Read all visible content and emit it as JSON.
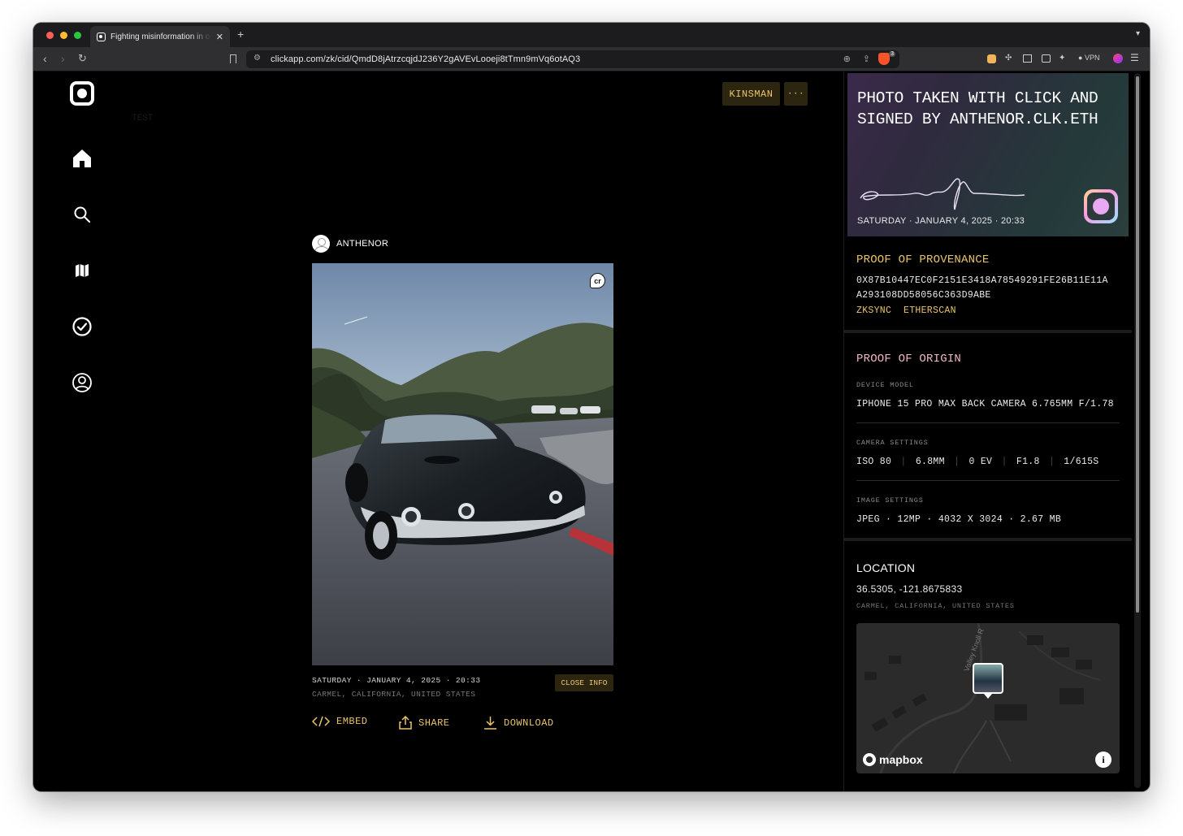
{
  "browser": {
    "tab_title": "Fighting misinformation in onchain photography",
    "url": "clickapp.com/zk/cid/QmdD8jAtrzcqjdJ236Y2gAVEvLooeji8tTmn9mVq6otAQ3",
    "vpn_label": "VPN",
    "brave_badge": "3"
  },
  "sidebar": {
    "ghost_text": "TEST",
    "items": [
      {
        "name": "home"
      },
      {
        "name": "search"
      },
      {
        "name": "map"
      },
      {
        "name": "verified"
      },
      {
        "name": "profile"
      }
    ]
  },
  "topbar": {
    "user_button": "KINSMAN",
    "more_button": "···"
  },
  "post": {
    "author": "ANTHENOR",
    "cr_badge": "cr",
    "date": "SATURDAY · JANUARY 4, 2025 · 20:33",
    "location": "CARMEL, CALIFORNIA, UNITED STATES",
    "close_info": "CLOSE INFO",
    "actions": {
      "embed": "EMBED",
      "share": "SHARE",
      "download": "DOWNLOAD"
    }
  },
  "panel": {
    "card": {
      "title": "PHOTO TAKEN WITH CLICK AND SIGNED BY ANTHENOR.CLK.ETH",
      "date": "SATURDAY · JANUARY 4, 2025 · 20:33"
    },
    "provenance": {
      "heading": "PROOF OF PROVENANCE",
      "hash_line1": "0X87B10447EC0F2151E3418A78549291FE26B11E11A",
      "hash_line2": "A293108DD58056C363D9ABE",
      "link1": "ZKSYNC",
      "link2": "ETHERSCAN"
    },
    "origin": {
      "heading": "PROOF OF ORIGIN",
      "device_label": "DEVICE MODEL",
      "device_value": "IPHONE 15 PRO MAX BACK CAMERA 6.765MM F/1.78",
      "camera_label": "CAMERA SETTINGS",
      "camera_values": [
        "ISO 80",
        "6.8MM",
        "0 EV",
        "F1.8",
        "1/615S"
      ],
      "image_label": "IMAGE SETTINGS",
      "image_value": "JPEG · 12MP · 4032 X 3024 · 2.67 MB"
    },
    "location": {
      "heading": "LOCATION",
      "coords": "36.5305, -121.8675833",
      "place": "CARMEL, CALIFORNIA, UNITED STATES",
      "street_label": "Valley Knoll R",
      "map_brand": "mapbox"
    }
  },
  "colors": {
    "accent": "#e9c46a",
    "accent_bg": "#2c2510",
    "origin_heading": "#f2b8c6",
    "background": "#000000"
  }
}
